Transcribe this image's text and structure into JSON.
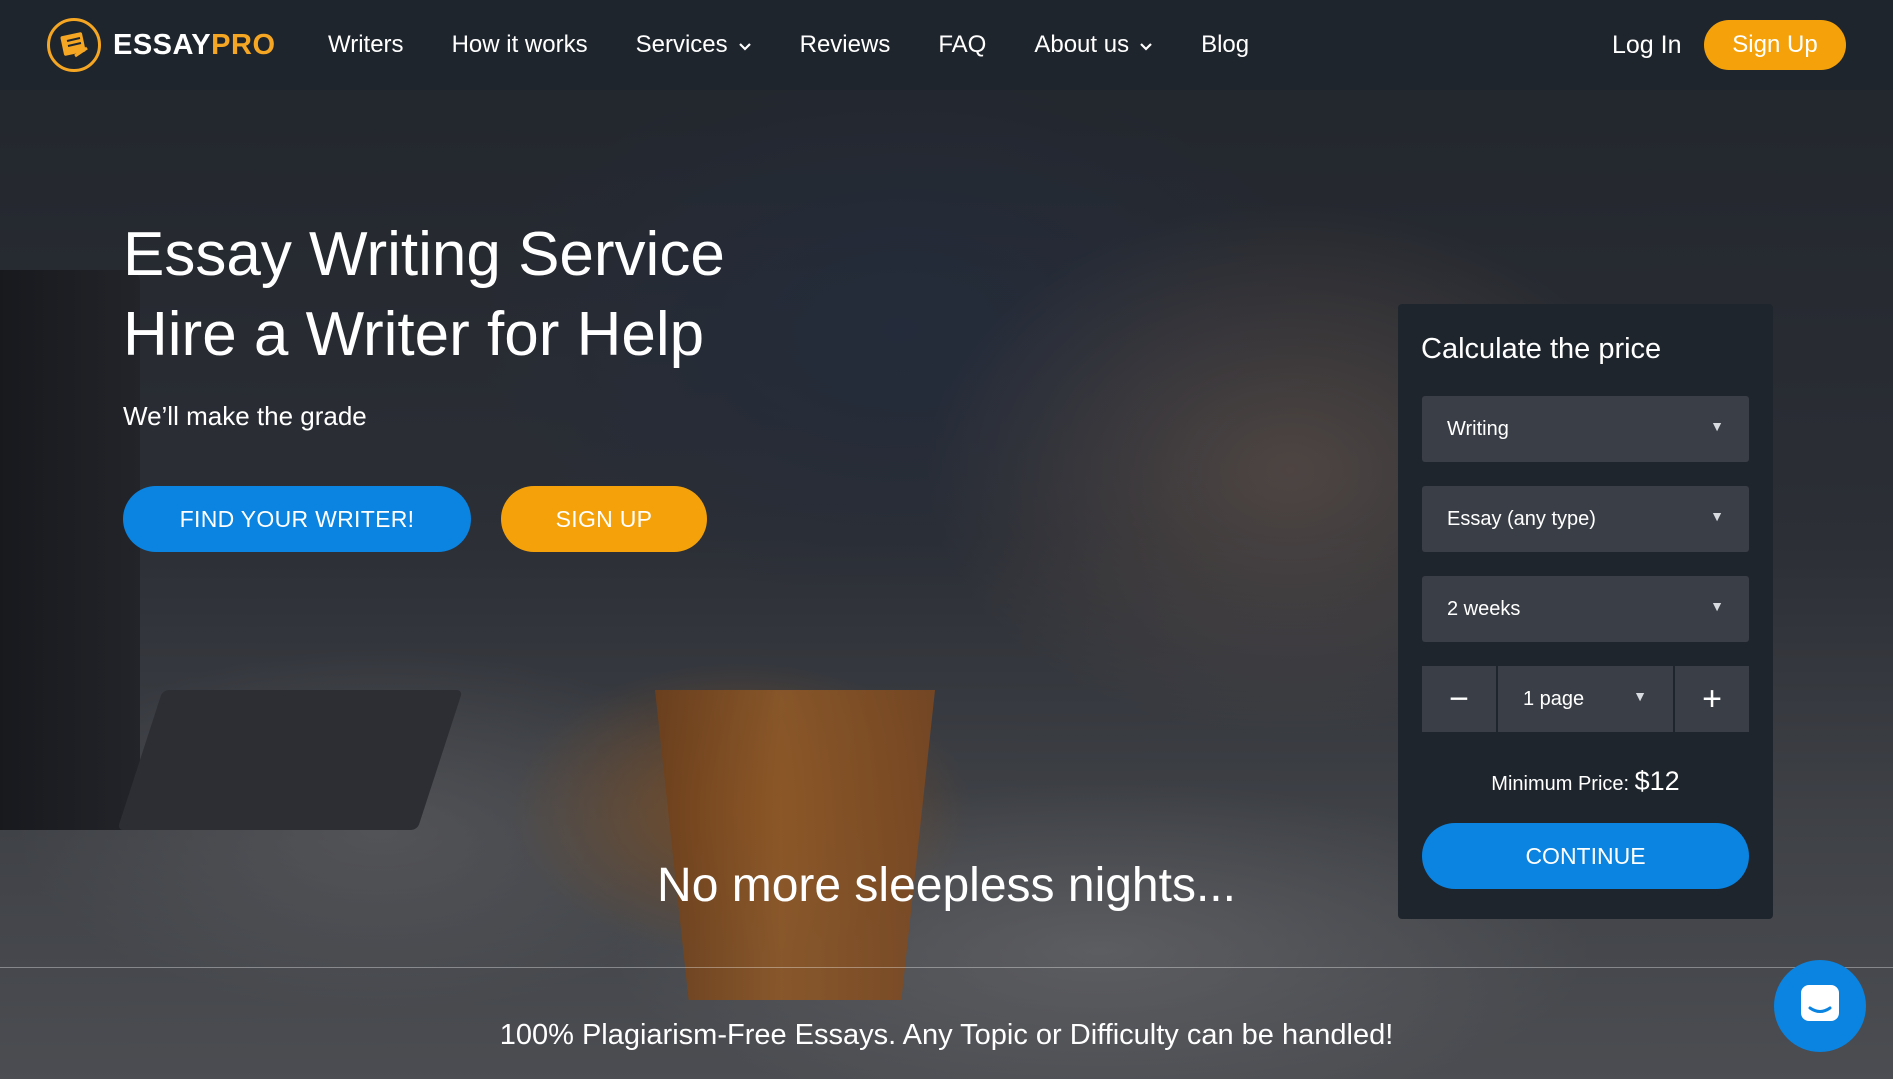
{
  "brand": {
    "name_main": "ESSAY",
    "name_accent": "PRO",
    "accent_color": "#f5a623"
  },
  "nav": {
    "items": [
      {
        "label": "Writers"
      },
      {
        "label": "How it works"
      },
      {
        "label": "Services"
      },
      {
        "label": "Reviews"
      },
      {
        "label": "FAQ"
      },
      {
        "label": "About us"
      },
      {
        "label": "Blog"
      }
    ],
    "login": "Log In",
    "signup": "Sign Up"
  },
  "hero": {
    "title_line1": "Essay Writing Service",
    "title_line2": "Hire a Writer for Help",
    "subtitle": "We’ll make the grade",
    "find_button": "FIND YOUR WRITER!",
    "signup_button": "SIGN UP",
    "tagline": "No more sleepless nights...",
    "bottom_text": "100% Plagiarism-Free Essays. Any Topic or Difficulty can be handled!"
  },
  "calculator": {
    "title": "Calculate the price",
    "service_type": "Writing",
    "paper_type": "Essay (any type)",
    "deadline": "2 weeks",
    "pages": "1 page",
    "minus": "−",
    "plus": "+",
    "min_price_label": "Minimum Price:",
    "min_price_value": "$12",
    "continue_button": "CONTINUE"
  },
  "colors": {
    "primary_blue": "#0a84e0",
    "orange": "#f5a20a",
    "nav_bg": "#1f252d"
  },
  "icons": [
    "logo-icon",
    "chevron-down-icon",
    "select-arrow-icon",
    "chat-icon"
  ]
}
